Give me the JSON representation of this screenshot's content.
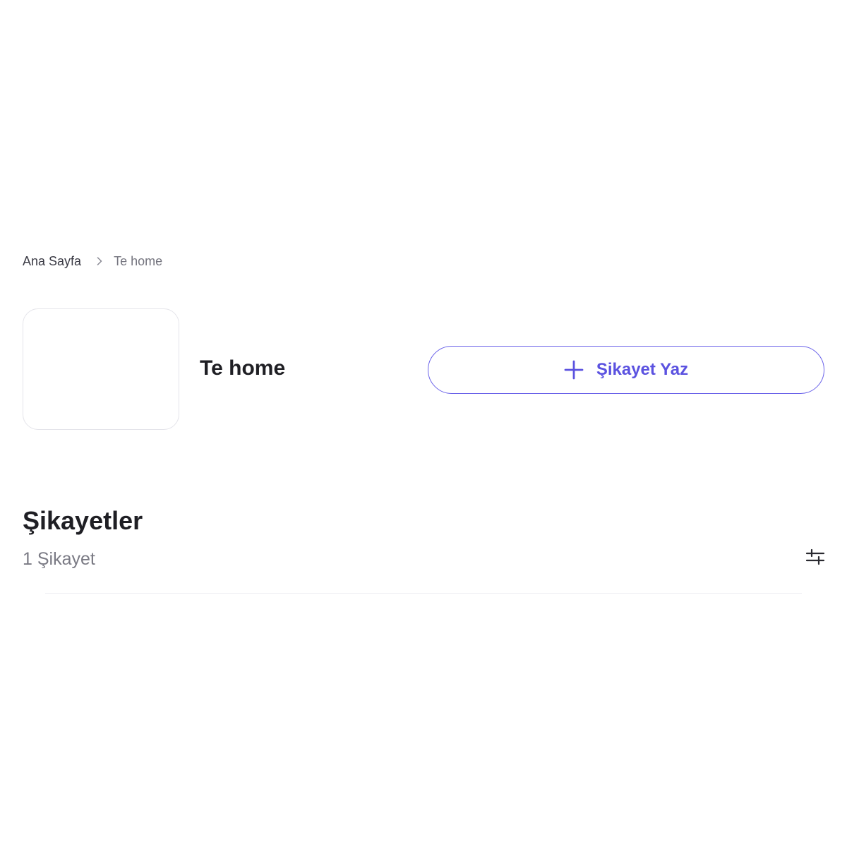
{
  "breadcrumb": {
    "home_label": "Ana Sayfa",
    "current_label": "Te home"
  },
  "brand": {
    "name": "Te home"
  },
  "actions": {
    "write_complaint_label": "Şikayet Yaz"
  },
  "complaints": {
    "title": "Şikayetler",
    "count_label": "1 Şikayet"
  },
  "icons": {
    "breadcrumb_separator": "chevron-right-icon",
    "write_button": "plus-icon",
    "filter": "sliders-icon"
  },
  "colors": {
    "accent": "#5b52e0",
    "accent_border": "#6b63e9",
    "text_primary": "#1f1f24",
    "text_muted": "#7a7a84"
  }
}
